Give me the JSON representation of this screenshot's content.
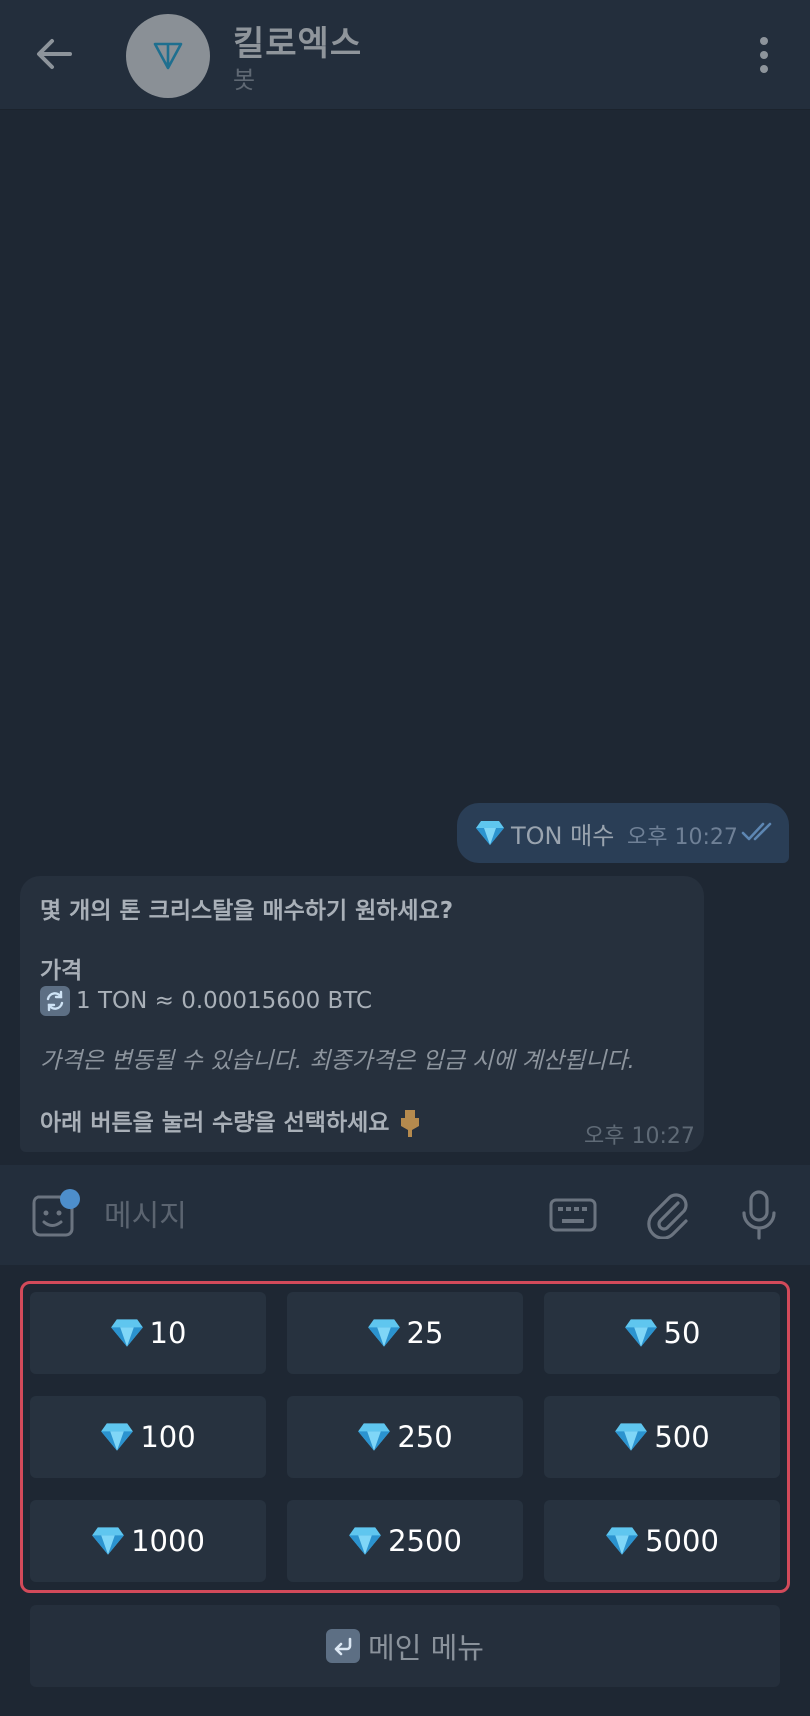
{
  "header": {
    "title": "킬로엑스",
    "subtitle": "봇"
  },
  "messages": {
    "outgoing": {
      "text": "TON 매수",
      "time": "오후 10:27"
    },
    "incoming": {
      "question": "몇 개의 톤 크리스탈을 매수하기 원하세요?",
      "price_heading": "가격",
      "price_line": "1 TON ≈ 0.00015600 BTC",
      "note": "가격은 변동될 수 있습니다. 최종가격은 입금 시에 계산됩니다.",
      "cta": "아래 버튼을 눌러 수량을 선택하세요",
      "time": "오후 10:27"
    }
  },
  "composer": {
    "placeholder": "메시지"
  },
  "keyboard": {
    "amounts": [
      "10",
      "25",
      "50",
      "100",
      "250",
      "500",
      "1000",
      "2500",
      "5000"
    ],
    "main_menu": "메인 메뉴"
  },
  "colors": {
    "accent_highlight": "#d24a5a",
    "diamond": "#5fc6ef"
  }
}
